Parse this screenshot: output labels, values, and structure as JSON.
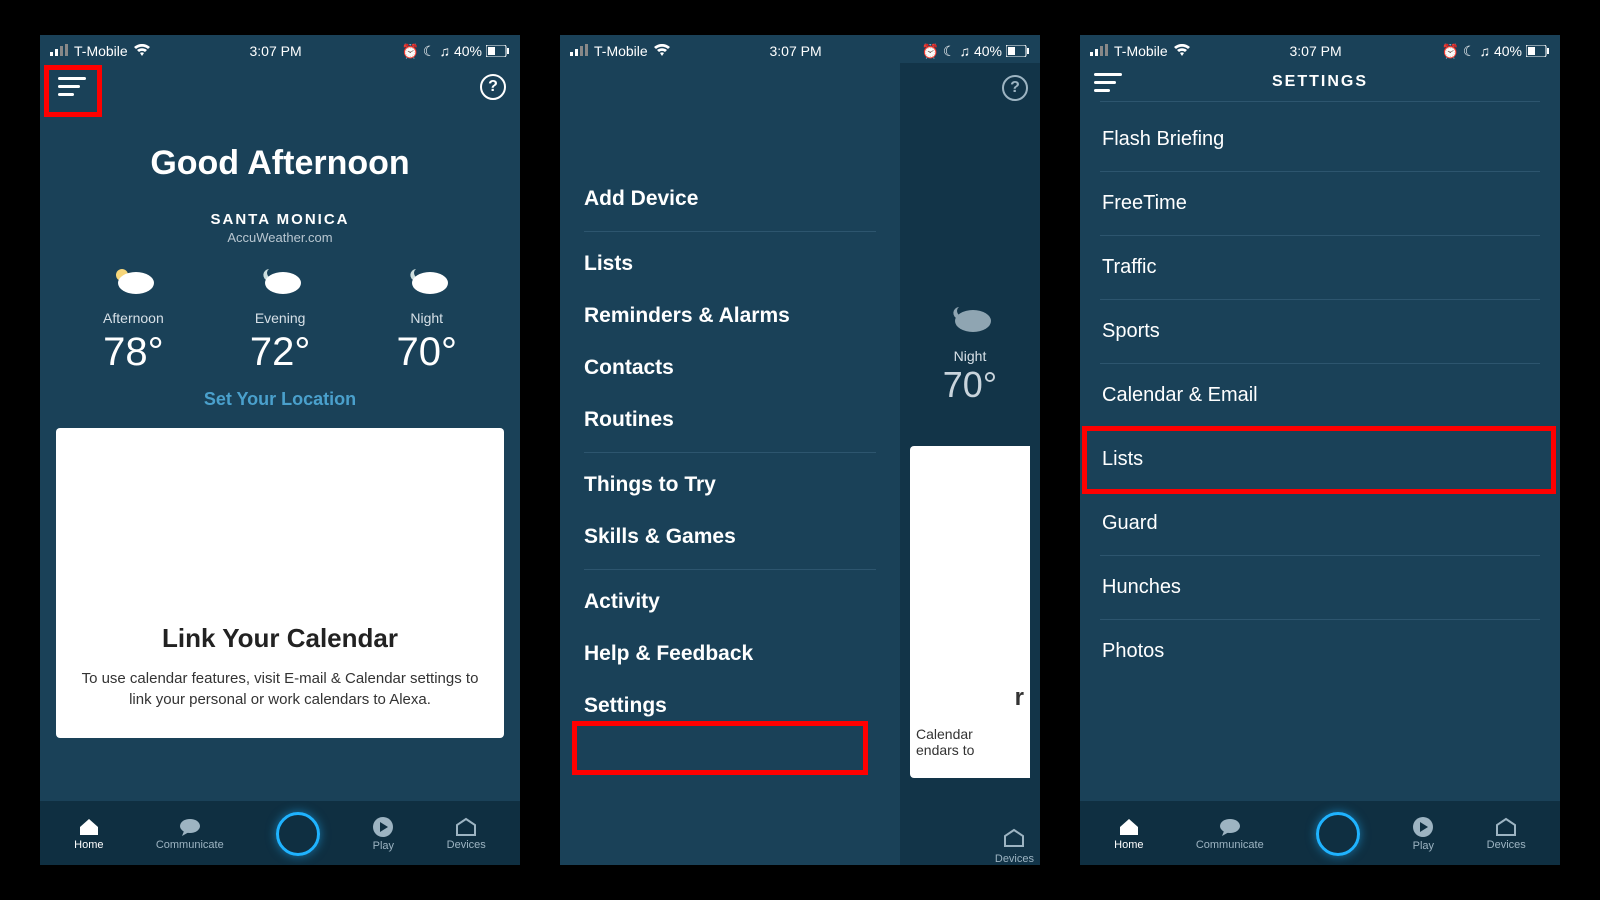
{
  "status": {
    "carrier": "T-Mobile",
    "time": "3:07 PM",
    "battery": "40%"
  },
  "screen1": {
    "greeting": "Good Afternoon",
    "location": "SANTA MONICA",
    "source": "AccuWeather.com",
    "weather": [
      {
        "label": "Afternoon",
        "temp": "78°"
      },
      {
        "label": "Evening",
        "temp": "72°"
      },
      {
        "label": "Night",
        "temp": "70°"
      }
    ],
    "set_location": "Set Your Location",
    "card_title": "Link Your Calendar",
    "card_body": "To use calendar features, visit E-mail & Calendar settings to link your personal or work calendars to Alexa."
  },
  "screen2": {
    "menu": [
      "Add Device",
      "Lists",
      "Reminders & Alarms",
      "Contacts",
      "Routines",
      "Things to Try",
      "Skills & Games",
      "Activity",
      "Help & Feedback",
      "Settings"
    ],
    "peek_label": "Night",
    "peek_temp": "70°",
    "peek_card1": "r",
    "peek_card2": "Calendar",
    "peek_card3": "endars to"
  },
  "screen3": {
    "title": "SETTINGS",
    "items": [
      "Flash Briefing",
      "FreeTime",
      "Traffic",
      "Sports",
      "Calendar & Email",
      "Lists",
      "Guard",
      "Hunches",
      "Photos"
    ]
  },
  "tabs": [
    {
      "label": "Home"
    },
    {
      "label": "Communicate"
    },
    {
      "label": ""
    },
    {
      "label": "Play"
    },
    {
      "label": "Devices"
    }
  ]
}
